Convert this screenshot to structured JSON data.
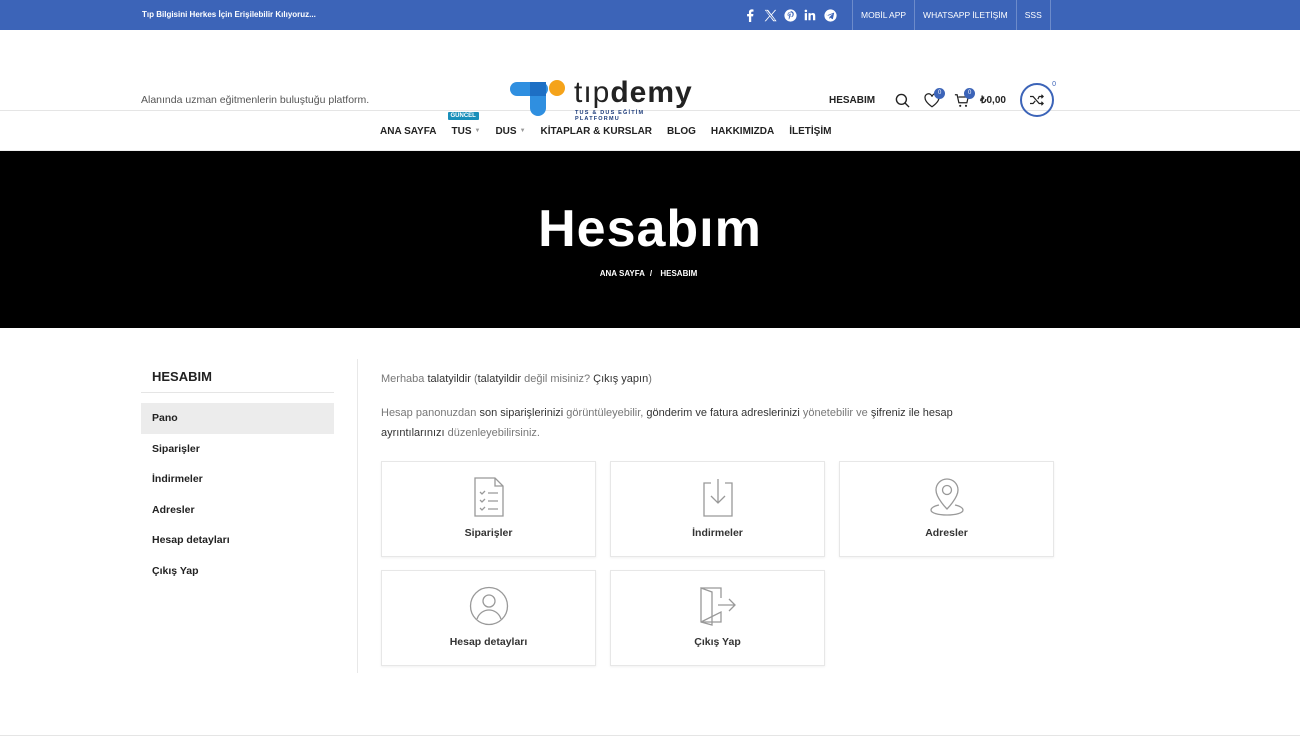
{
  "topbar": {
    "tagline": "Tıp Bilgisini Herkes İçin Erişilebilir Kılıyoruz...",
    "social_icons": [
      "facebook-icon",
      "x-twitter-icon",
      "pinterest-icon",
      "linkedin-icon",
      "telegram-icon"
    ],
    "links": [
      "MOBİL APP",
      "WHATSAPP İLETİŞİM",
      "SSS"
    ],
    "bg_color": "#3c64b8"
  },
  "header": {
    "slogan": "Alanında uzman eğitmenlerin buluştuğu platform.",
    "logo": {
      "wordmark_light": "tıp",
      "wordmark_bold": "demy",
      "subtitle": "TUS & DUS EĞİTİM PLATFORMU"
    },
    "account_label": "HESABIM",
    "wishlist_count": "0",
    "cart_count": "0",
    "cart_total": "₺0,00",
    "compare_count": "0"
  },
  "nav": {
    "items": [
      {
        "label": "ANA SAYFA",
        "dropdown": false
      },
      {
        "label": "TUS",
        "dropdown": true,
        "badge": "GÜNCEL"
      },
      {
        "label": "DUS",
        "dropdown": true
      },
      {
        "label": "KİTAPLAR & KURSLAR",
        "dropdown": false
      },
      {
        "label": "BLOG",
        "dropdown": false
      },
      {
        "label": "HAKKIMIZDA",
        "dropdown": false
      },
      {
        "label": "İLETİŞİM",
        "dropdown": false
      }
    ]
  },
  "hero": {
    "title": "Hesabım",
    "breadcrumb": [
      "ANA SAYFA",
      "/",
      "HESABIM"
    ]
  },
  "sidebar": {
    "title": "HESABIM",
    "items": [
      "Pano",
      "Siparişler",
      "İndirmeler",
      "Adresler",
      "Hesap detayları",
      "Çıkış Yap"
    ],
    "active_index": 0
  },
  "main": {
    "greeting": {
      "t1": "Merhaba ",
      "user": "talatyildir",
      "t2": " (",
      "user2": "talatyildir",
      "t3": " değil misiniz? ",
      "logout": "Çıkış yapın",
      "t4": ")"
    },
    "intro": {
      "t1": "Hesap panonuzdan ",
      "l1": "son siparişlerinizi",
      "t2": " görüntüleyebilir, ",
      "l2": "gönderim ve fatura adreslerinizi",
      "t3": " yönetebilir ve ",
      "l3": "şifreniz ile hesap ayrıntılarınızı",
      "t4": " düzenleyebilirsiniz."
    },
    "cards": [
      {
        "label": "Siparişler",
        "icon": "orders-checklist-icon"
      },
      {
        "label": "İndirmeler",
        "icon": "download-icon"
      },
      {
        "label": "Adresler",
        "icon": "location-pin-icon"
      },
      {
        "label": "Hesap detayları",
        "icon": "user-account-icon"
      },
      {
        "label": "Çıkış Yap",
        "icon": "logout-door-icon"
      }
    ]
  },
  "colors": {
    "accent": "#3c64b8",
    "logo_blue": "#2f8fe0",
    "logo_orange": "#f5a31a",
    "new_badge": "#1a8fba"
  }
}
